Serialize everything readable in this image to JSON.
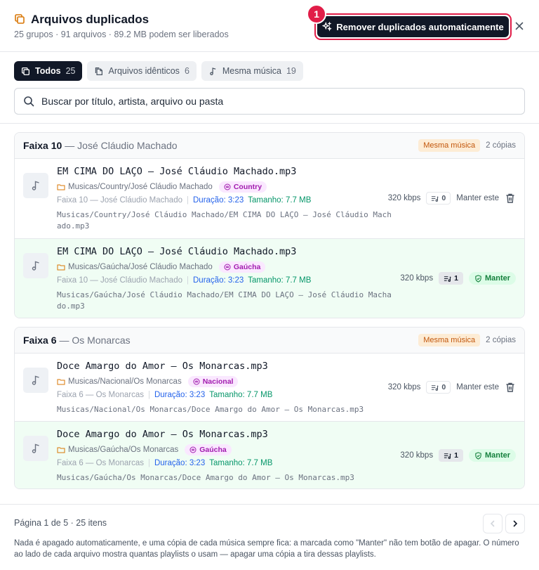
{
  "header": {
    "title": "Arquivos duplicados",
    "subtitle": "25 grupos · 91 arquivos · 89.2 MB podem ser liberados",
    "auto_button": "Remover duplicados automaticamente",
    "step_badge": "1"
  },
  "tabs": [
    {
      "label": "Todos",
      "count": "25"
    },
    {
      "label": "Arquivos idênticos",
      "count": "6"
    },
    {
      "label": "Mesma música",
      "count": "19"
    }
  ],
  "search": {
    "placeholder": "Buscar por título, artista, arquivo ou pasta"
  },
  "groups": [
    {
      "title": "Faixa 10",
      "artist": "— José Cláudio Machado",
      "type_badge": "Mesma música",
      "copies": "2 cópias",
      "files": [
        {
          "filename": "EM CIMA DO LAÇO – José Cláudio Machado.mp3",
          "folder": "Musicas/Country/José Cláudio Machado",
          "genre": "Country",
          "track": "Faixa 10 — José Cláudio Machado",
          "duration": "Duração: 3:23",
          "size": "Tamanho: 7.7 MB",
          "path": "Musicas/Country/José Cláudio Machado/EM CIMA DO LAÇO – José Cláudio Machado.mp3",
          "bitrate": "320 kbps",
          "playlists": "0",
          "action": "Manter este"
        },
        {
          "filename": "EM CIMA DO LAÇO – José Cláudio Machado.mp3",
          "folder": "Musicas/Gaúcha/José Cláudio Machado",
          "genre": "Gaúcha",
          "track": "Faixa 10 — José Cláudio Machado",
          "duration": "Duração: 3:23",
          "size": "Tamanho: 7.7 MB",
          "path": "Musicas/Gaúcha/José Cláudio Machado/EM CIMA DO LAÇO – José Cláudio Machado.mp3",
          "bitrate": "320 kbps",
          "playlists": "1",
          "action": "Manter"
        }
      ]
    },
    {
      "title": "Faixa 6",
      "artist": "— Os Monarcas",
      "type_badge": "Mesma música",
      "copies": "2 cópias",
      "files": [
        {
          "filename": "Doce Amargo do Amor – Os Monarcas.mp3",
          "folder": "Musicas/Nacional/Os Monarcas",
          "genre": "Nacional",
          "track": "Faixa 6 — Os Monarcas",
          "duration": "Duração: 3:23",
          "size": "Tamanho: 7.7 MB",
          "path": "Musicas/Nacional/Os Monarcas/Doce Amargo do Amor – Os Monarcas.mp3",
          "bitrate": "320 kbps",
          "playlists": "0",
          "action": "Manter este"
        },
        {
          "filename": "Doce Amargo do Amor – Os Monarcas.mp3",
          "folder": "Musicas/Gaúcha/Os Monarcas",
          "genre": "Gaúcha",
          "track": "Faixa 6 — Os Monarcas",
          "duration": "Duração: 3:23",
          "size": "Tamanho: 7.7 MB",
          "path": "Musicas/Gaúcha/Os Monarcas/Doce Amargo do Amor – Os Monarcas.mp3",
          "bitrate": "320 kbps",
          "playlists": "1",
          "action": "Manter"
        }
      ]
    }
  ],
  "footer": {
    "page_info": "Página 1 de 5 · 25 itens",
    "note": "Nada é apagado automaticamente, e uma cópia de cada música sempre fica: a marcada como \"Manter\" não tem botão de apagar. O número ao lado de cada arquivo mostra quantas playlists o usam — apagar uma cópia a tira dessas playlists."
  },
  "colors": {
    "accent": "#111827",
    "highlight": "#e11d48",
    "keep_bg": "#f0fdf4",
    "genre": "#a21caf",
    "duration": "#2563eb",
    "size": "#059669"
  }
}
